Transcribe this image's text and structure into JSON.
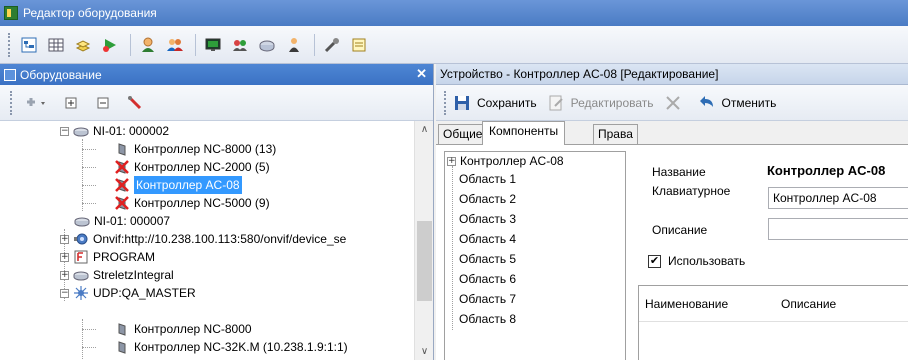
{
  "window": {
    "title": "Редактор оборудования"
  },
  "left_panel": {
    "title": "Оборудование",
    "close_glyph": "✕",
    "tree": [
      {
        "label": "NI-01: 000002",
        "type": "ni"
      },
      {
        "label": "Контроллер NC-8000 (13)",
        "type": "controller"
      },
      {
        "label": "Контроллер NC-2000 (5)",
        "type": "controller-x"
      },
      {
        "label": "Контроллер AC-08",
        "type": "controller-x",
        "selected": true
      },
      {
        "label": "Контроллер NC-5000 (9)",
        "type": "controller-x"
      },
      {
        "label": "NI-01: 000007",
        "type": "ni"
      },
      {
        "label": "Onvif:http://10.238.100.113:580/onvif/device_se",
        "type": "onvif"
      },
      {
        "label": "PROGRAM",
        "type": "program"
      },
      {
        "label": "StreletzIntegral",
        "type": "streletz"
      },
      {
        "label": "UDP:QA_MASTER",
        "type": "udp"
      },
      {
        "label": "Контроллер NC-8000",
        "type": "controller"
      },
      {
        "label": "Контроллер NC-32K.M (10.238.1.9:1:1)",
        "type": "controller"
      }
    ]
  },
  "right_panel": {
    "title": "Устройство - Контроллер AC-08 [Редактирование]",
    "toolbar": {
      "save": "Сохранить",
      "edit": "Редактировать",
      "cancel": "Отменить"
    },
    "tabs": [
      "Общие",
      "Компоненты",
      "Права"
    ],
    "component_tree": [
      "Контроллер AC-08",
      "Область 1",
      "Область 2",
      "Область 3",
      "Область 4",
      "Область 5",
      "Область 6",
      "Область 7",
      "Область 8"
    ],
    "form": {
      "name_label": "Название",
      "name_value": "Контроллер AC-08",
      "keyboard_label": "Клавиатурное",
      "keyboard_value": "Контроллер AC-08",
      "description_label": "Описание",
      "description_value": "",
      "use_label": "Использовать",
      "use_checked": true,
      "check_glyph": "✔"
    },
    "grid_headers": [
      "Наименование",
      "Описание"
    ]
  },
  "tree_glyphs": {
    "minus": "−",
    "plus": "+"
  },
  "scroll_glyphs": {
    "up": "∧",
    "down": "∨"
  },
  "colors": {
    "titlebar": "#4a7bc4",
    "selection": "#3399ff"
  }
}
